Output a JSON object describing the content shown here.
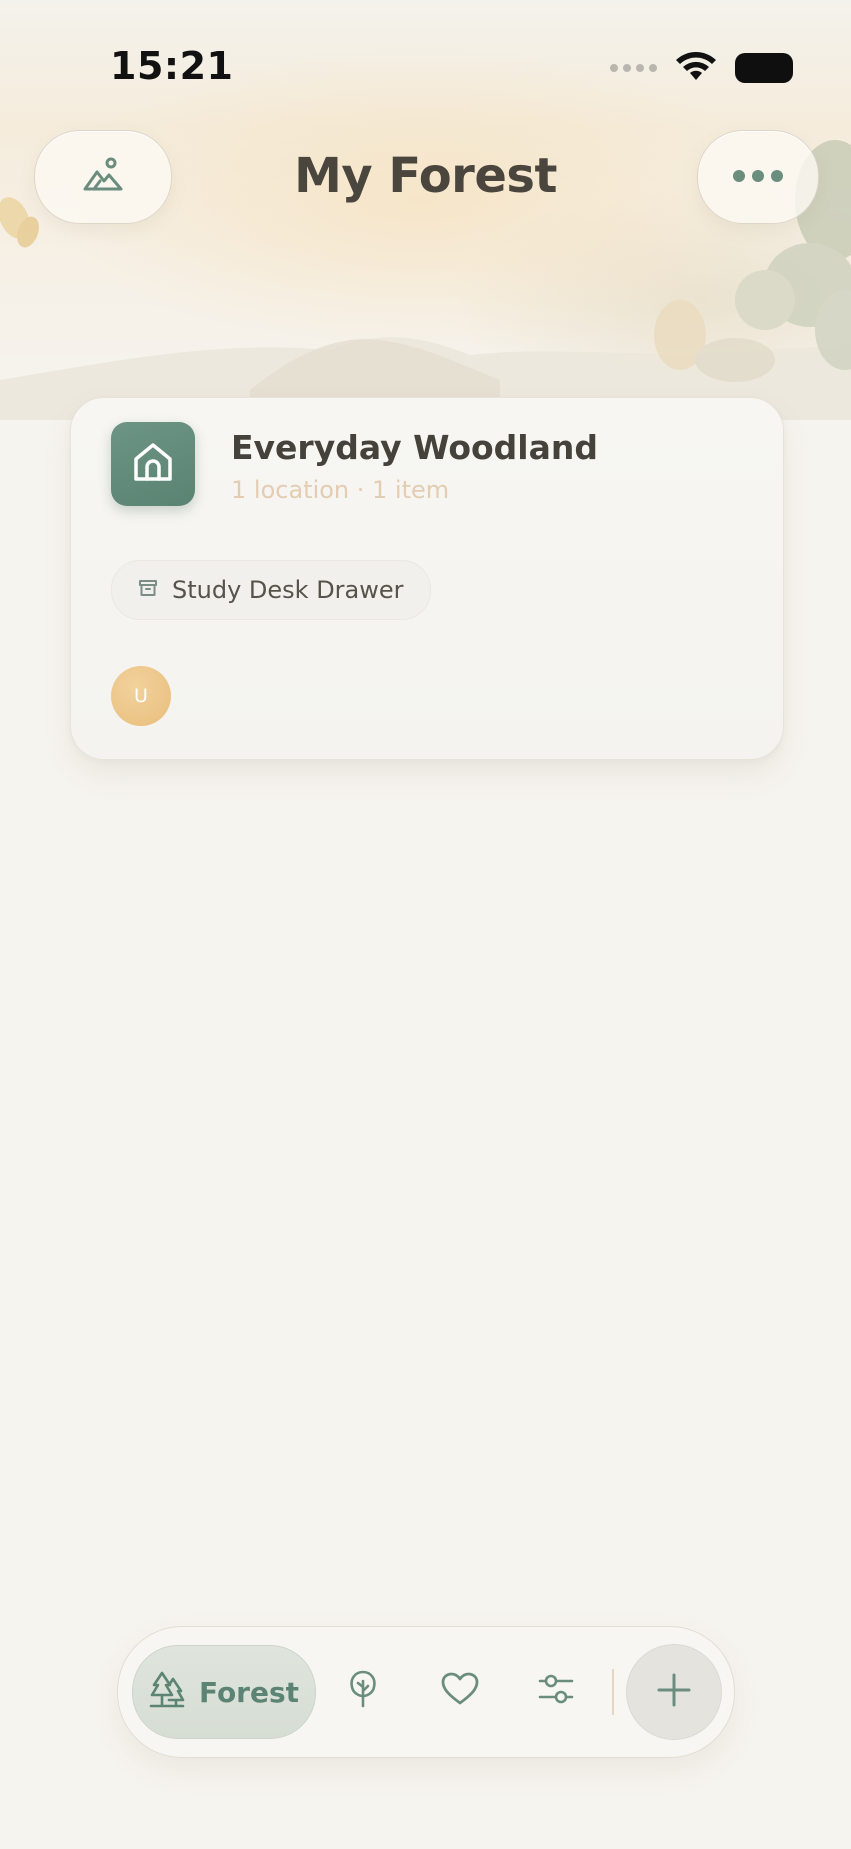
{
  "status_bar": {
    "time": "15:21"
  },
  "header": {
    "title": "My Forest",
    "left_icon": "mountain-icon",
    "right_icon": "ellipsis-icon"
  },
  "card": {
    "icon": "home-icon",
    "title": "Everyday Woodland",
    "subtitle": "1 location · 1 item",
    "chip": {
      "icon": "archive-box-icon",
      "label": "Study Desk Drawer"
    },
    "avatar_initial": "U"
  },
  "tab_bar": {
    "active_tab": {
      "icon": "pine-trees-icon",
      "label": "Forest"
    },
    "tabs": [
      {
        "icon": "tree-icon"
      },
      {
        "icon": "heart-icon"
      },
      {
        "icon": "sliders-icon"
      }
    ],
    "add_icon": "plus-icon"
  },
  "colors": {
    "accent_green": "#5c8474",
    "card_icon_bg": "#6d9484",
    "subtitle_tan": "#e3cdb2",
    "avatar": "#e8bd7c"
  }
}
